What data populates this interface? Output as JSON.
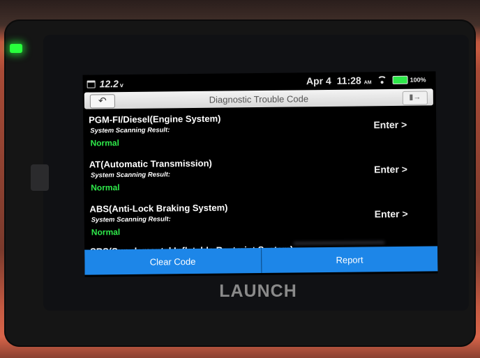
{
  "status": {
    "voltage": "12.2",
    "voltage_unit": "v",
    "date": "Apr 4",
    "time": "11:28",
    "ampm": "AM",
    "battery": "100%"
  },
  "titlebar": {
    "title": "Diagnostic Trouble Code"
  },
  "systems": [
    {
      "name": "PGM-FI/Diesel(Engine System)",
      "label": "System Scanning Result:",
      "result": "Normal",
      "action": "Enter >"
    },
    {
      "name": "AT(Automatic Transmission)",
      "label": "System Scanning Result:",
      "result": "Normal",
      "action": "Enter >"
    },
    {
      "name": "ABS(Anti-Lock Braking System)",
      "label": "System Scanning Result:",
      "result": "Normal",
      "action": "Enter >"
    }
  ],
  "partial_system": "SRS(Supplemental Inflatable Restraint System)",
  "bottom": {
    "clear_code": "Clear Code",
    "report": "Report"
  },
  "device": {
    "brand": "LAUNCH"
  },
  "colors": {
    "accent_blue": "#1d86e8",
    "normal_green": "#2ee84a",
    "case_orange": "#c65a40"
  }
}
